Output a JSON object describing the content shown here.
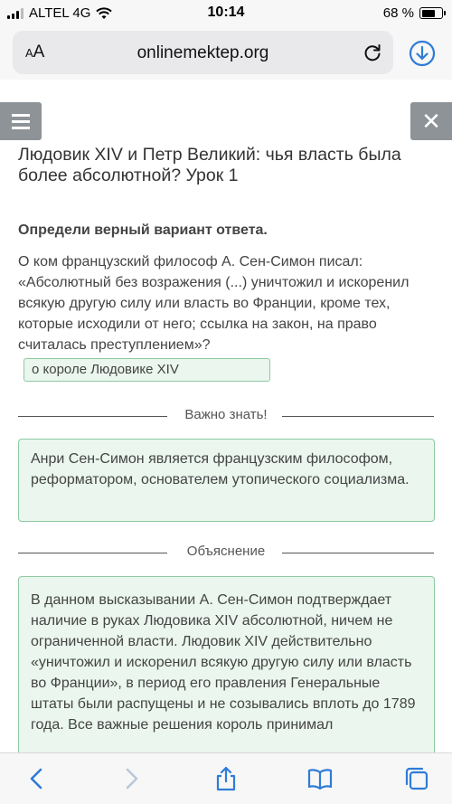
{
  "status": {
    "carrier": "ALTEL 4G",
    "time": "10:14",
    "battery": "68 %",
    "battery_level": 0.68
  },
  "browser": {
    "aa_small": "A",
    "aa_large": "A",
    "url": "onlinemektep.org"
  },
  "page": {
    "title": "Людовик XIV и Петр Великий: чья власть была более абсолютной? Урок 1",
    "question_heading": "Определи верный вариант ответа.",
    "question_text": "О ком французский философ А. Сен-Симон писал: «Абсолютный без возражения (...) уничтожил и искоренил всякую другую силу или власть во Франции, кроме тех, которые исходили от него; ссылка на закон, на право считалась преступлением»?",
    "answer": "о короле Людовике XIV",
    "important_label": "Важно знать!",
    "important_text": "Анри Сен-Симон является французским философом, реформатором, основателем утопического социализма.",
    "explanation_label": "Объяснение",
    "explanation_text": "В данном высказывании А. Сен-Симон подтверждает наличие в руках Людовика XIV абсолютной, ничем не ограниченной власти. Людовик XIV действительно «уничтожил и искоренил всякую другую силу или власть во Франции», в период его правления Генеральные штаты были распущены и не созывались вплоть до 1789 года. Все важные решения король принимал"
  },
  "colors": {
    "accent": "#2f7cd6",
    "answer_border": "#8ec9a2",
    "answer_bg": "#eaf6ee",
    "header_button": "#8d9397"
  },
  "icons": [
    "signal-icon",
    "wifi-icon",
    "battery-icon",
    "reload-icon",
    "download-icon",
    "menu-icon",
    "close-icon",
    "back-icon",
    "forward-icon",
    "share-icon",
    "bookmarks-icon",
    "tabs-icon"
  ]
}
